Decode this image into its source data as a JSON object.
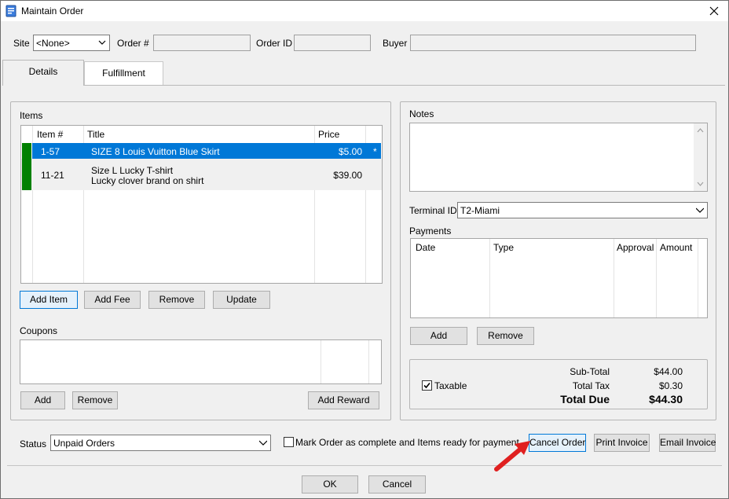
{
  "window": {
    "title": "Maintain Order"
  },
  "header": {
    "site_label": "Site",
    "site_value": "<None>",
    "order_num_label": "Order #",
    "order_num_value": "",
    "order_id_label": "Order ID",
    "order_id_value": "",
    "buyer_label": "Buyer",
    "buyer_value": ""
  },
  "tabs": [
    {
      "label": "Details"
    },
    {
      "label": "Fulfillment"
    }
  ],
  "items": {
    "label": "Items",
    "columns": [
      "Item #",
      "Title",
      "Price"
    ],
    "rows": [
      {
        "item_num": "1-57",
        "title_line1": "SIZE 8 Louis Vuitton Blue Skirt",
        "title_line2": "",
        "price": "$5.00",
        "marker": "*"
      },
      {
        "item_num": "11-21",
        "title_line1": "Size L Lucky T-shirt",
        "title_line2": "Lucky clover brand on shirt",
        "price": "$39.00",
        "marker": ""
      }
    ],
    "buttons": {
      "add_item": "Add Item",
      "add_fee": "Add Fee",
      "remove": "Remove",
      "update": "Update"
    }
  },
  "coupons": {
    "label": "Coupons",
    "buttons": {
      "add": "Add",
      "remove": "Remove",
      "add_reward": "Add Reward"
    }
  },
  "notes": {
    "label": "Notes",
    "value": ""
  },
  "terminal": {
    "label": "Terminal ID",
    "value": "T2-Miami"
  },
  "payments": {
    "label": "Payments",
    "columns": [
      "Date",
      "Type",
      "Approval",
      "Amount"
    ],
    "buttons": {
      "add": "Add",
      "remove": "Remove"
    }
  },
  "totals": {
    "taxable_label": "Taxable",
    "taxable_checked": true,
    "subtotal_label": "Sub-Total",
    "subtotal_value": "$44.00",
    "tax_label": "Total Tax",
    "tax_value": "$0.30",
    "due_label": "Total Due",
    "due_value": "$44.30"
  },
  "status": {
    "label": "Status",
    "value": "Unpaid Orders",
    "complete_label": "Mark Order as complete and Items ready for payment."
  },
  "actions": {
    "cancel_order": "Cancel Order",
    "print_invoice": "Print Invoice",
    "email_invoice": "Email Invoice",
    "ok": "OK",
    "cancel": "Cancel"
  },
  "colors": {
    "selection": "#0078d7",
    "row_indicator": "#008000",
    "annotation_arrow": "#e02020"
  }
}
